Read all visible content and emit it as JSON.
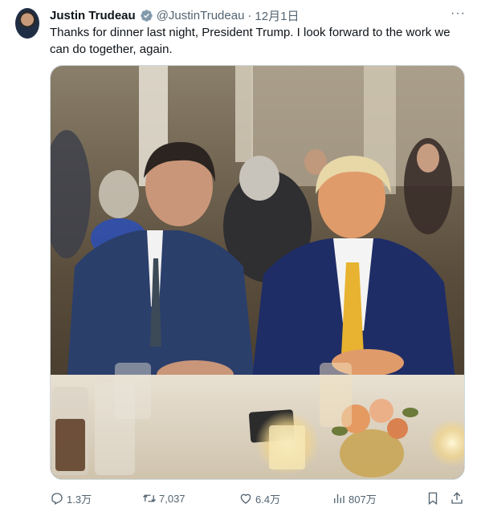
{
  "tweet": {
    "display_name": "Justin Trudeau",
    "handle": "@JustinTrudeau",
    "separator": "·",
    "date": "12月1日",
    "more": "···",
    "text": "Thanks for dinner last night, President Trump. I look forward to the work we can do together, again."
  },
  "actions": {
    "replies": "1.3万",
    "retweets": "7,037",
    "likes": "6.4万",
    "views": "807万"
  },
  "colors": {
    "verified": "#1d9bf0",
    "secondary_text": "#536471"
  },
  "icons": [
    "verified-icon",
    "reply-icon",
    "retweet-icon",
    "like-icon",
    "views-icon",
    "bookmark-icon",
    "share-icon"
  ]
}
